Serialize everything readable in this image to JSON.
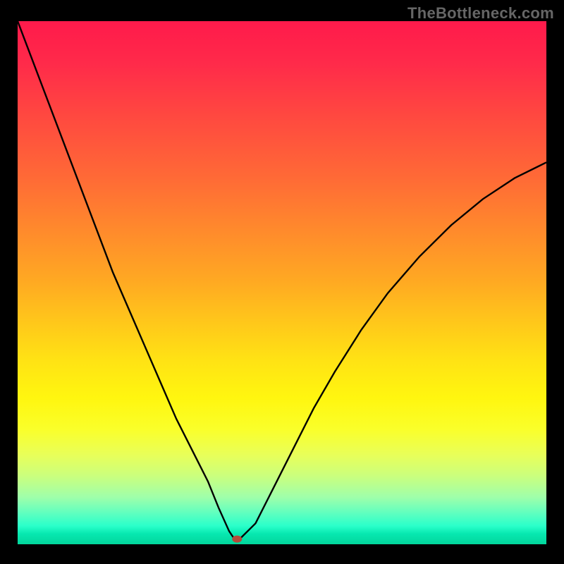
{
  "watermark": "TheBottleneck.com",
  "chart_data": {
    "type": "line",
    "title": "",
    "xlabel": "",
    "ylabel": "",
    "xlim": [
      0,
      100
    ],
    "ylim": [
      0,
      100
    ],
    "grid": false,
    "legend": false,
    "annotations": [],
    "series": [
      {
        "name": "bottleneck-curve",
        "x": [
          0,
          3,
          6,
          9,
          12,
          15,
          18,
          21,
          24,
          27,
          30,
          33,
          36,
          38,
          40,
          41,
          42,
          45,
          48,
          52,
          56,
          60,
          65,
          70,
          76,
          82,
          88,
          94,
          100
        ],
        "y": [
          100,
          92,
          84,
          76,
          68,
          60,
          52,
          45,
          38,
          31,
          24,
          18,
          12,
          7,
          2.5,
          1,
          1,
          4,
          10,
          18,
          26,
          33,
          41,
          48,
          55,
          61,
          66,
          70,
          73
        ]
      }
    ],
    "marker": {
      "x": 41.5,
      "y": 1
    },
    "background_gradient": {
      "top": "#ff1a4b",
      "mid": "#ffe314",
      "bottom": "#02d69c"
    }
  }
}
